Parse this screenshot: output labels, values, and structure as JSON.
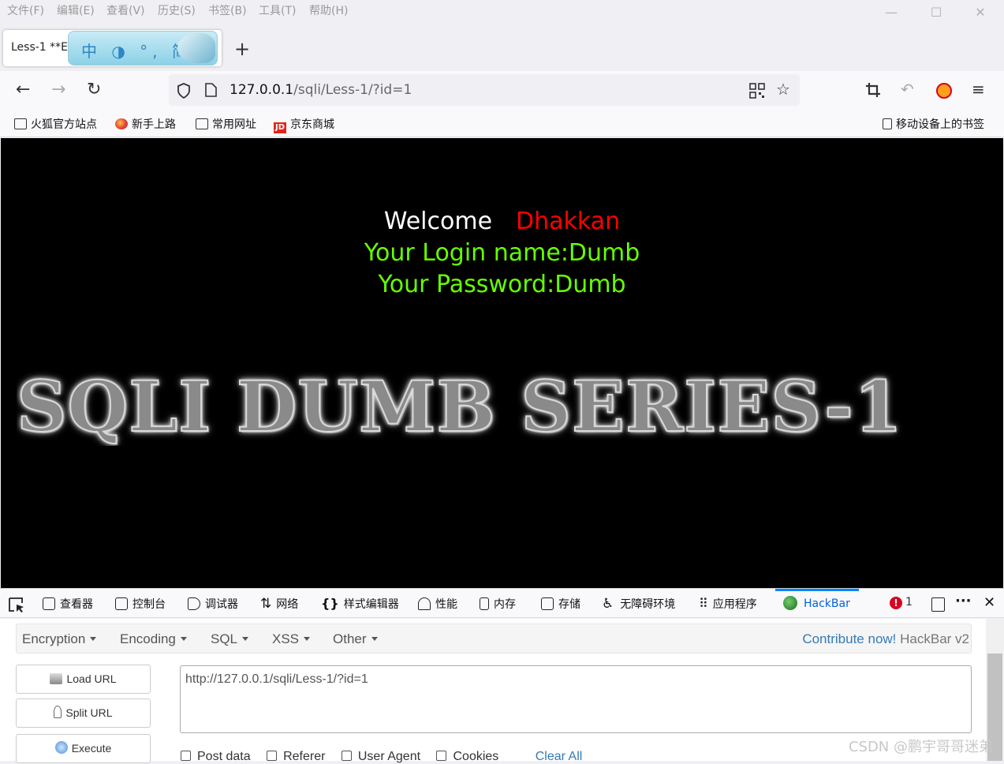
{
  "menubar": {
    "items": [
      "文件(F)",
      "编辑(E)",
      "查看(V)",
      "历史(S)",
      "书签(B)",
      "工具(T)",
      "帮助(H)"
    ]
  },
  "window": {
    "minimize": "—",
    "maximize": "☐",
    "close": "✕"
  },
  "tab": {
    "title": "Less-1 **E",
    "ime_text": "中 ◑ °, 简",
    "new_tab": "+"
  },
  "nav": {
    "back": "←",
    "forward": "→",
    "reload": "↻",
    "url_host": "127.0.0.1",
    "url_path": "/sqli/Less-1/?id=1"
  },
  "bookmarks": {
    "items": [
      "火狐官方站点",
      "新手上路",
      "常用网址",
      "京东商城"
    ],
    "mobile": "移动设备上的书签",
    "jd_logo": "JD"
  },
  "page": {
    "welcome": "Welcome",
    "name": "Dhakkan",
    "login_line": "Your Login name:Dumb",
    "password_line": "Your Password:Dumb",
    "banner": "SQLI DUMB SERIES-1"
  },
  "devtools": {
    "tabs": [
      "查看器",
      "控制台",
      "调试器",
      "网络",
      "样式编辑器",
      "性能",
      "内存",
      "存储",
      "无障碍环境",
      "应用程序",
      "HackBar"
    ],
    "error_count": "1",
    "error_badge": "!"
  },
  "hackbar": {
    "menus": [
      "Encryption",
      "Encoding",
      "SQL",
      "XSS",
      "Other"
    ],
    "contribute": "Contribute now!",
    "contribute_tail": " HackBar v2",
    "load_url": "Load URL",
    "split_url": "Split URL",
    "execute": "Execute",
    "url_value": "http://127.0.0.1/sqli/Less-1/?id=1",
    "options": [
      "Post data",
      "Referer",
      "User Agent",
      "Cookies"
    ],
    "clear_all": "Clear All"
  },
  "watermark": "CSDN @鹏宇哥哥迷弟",
  "colors": {
    "welcome": "#ffffff",
    "name": "#ff0000",
    "info": "#66ff00",
    "link": "#337ab7",
    "active_tab": "#0060df"
  }
}
